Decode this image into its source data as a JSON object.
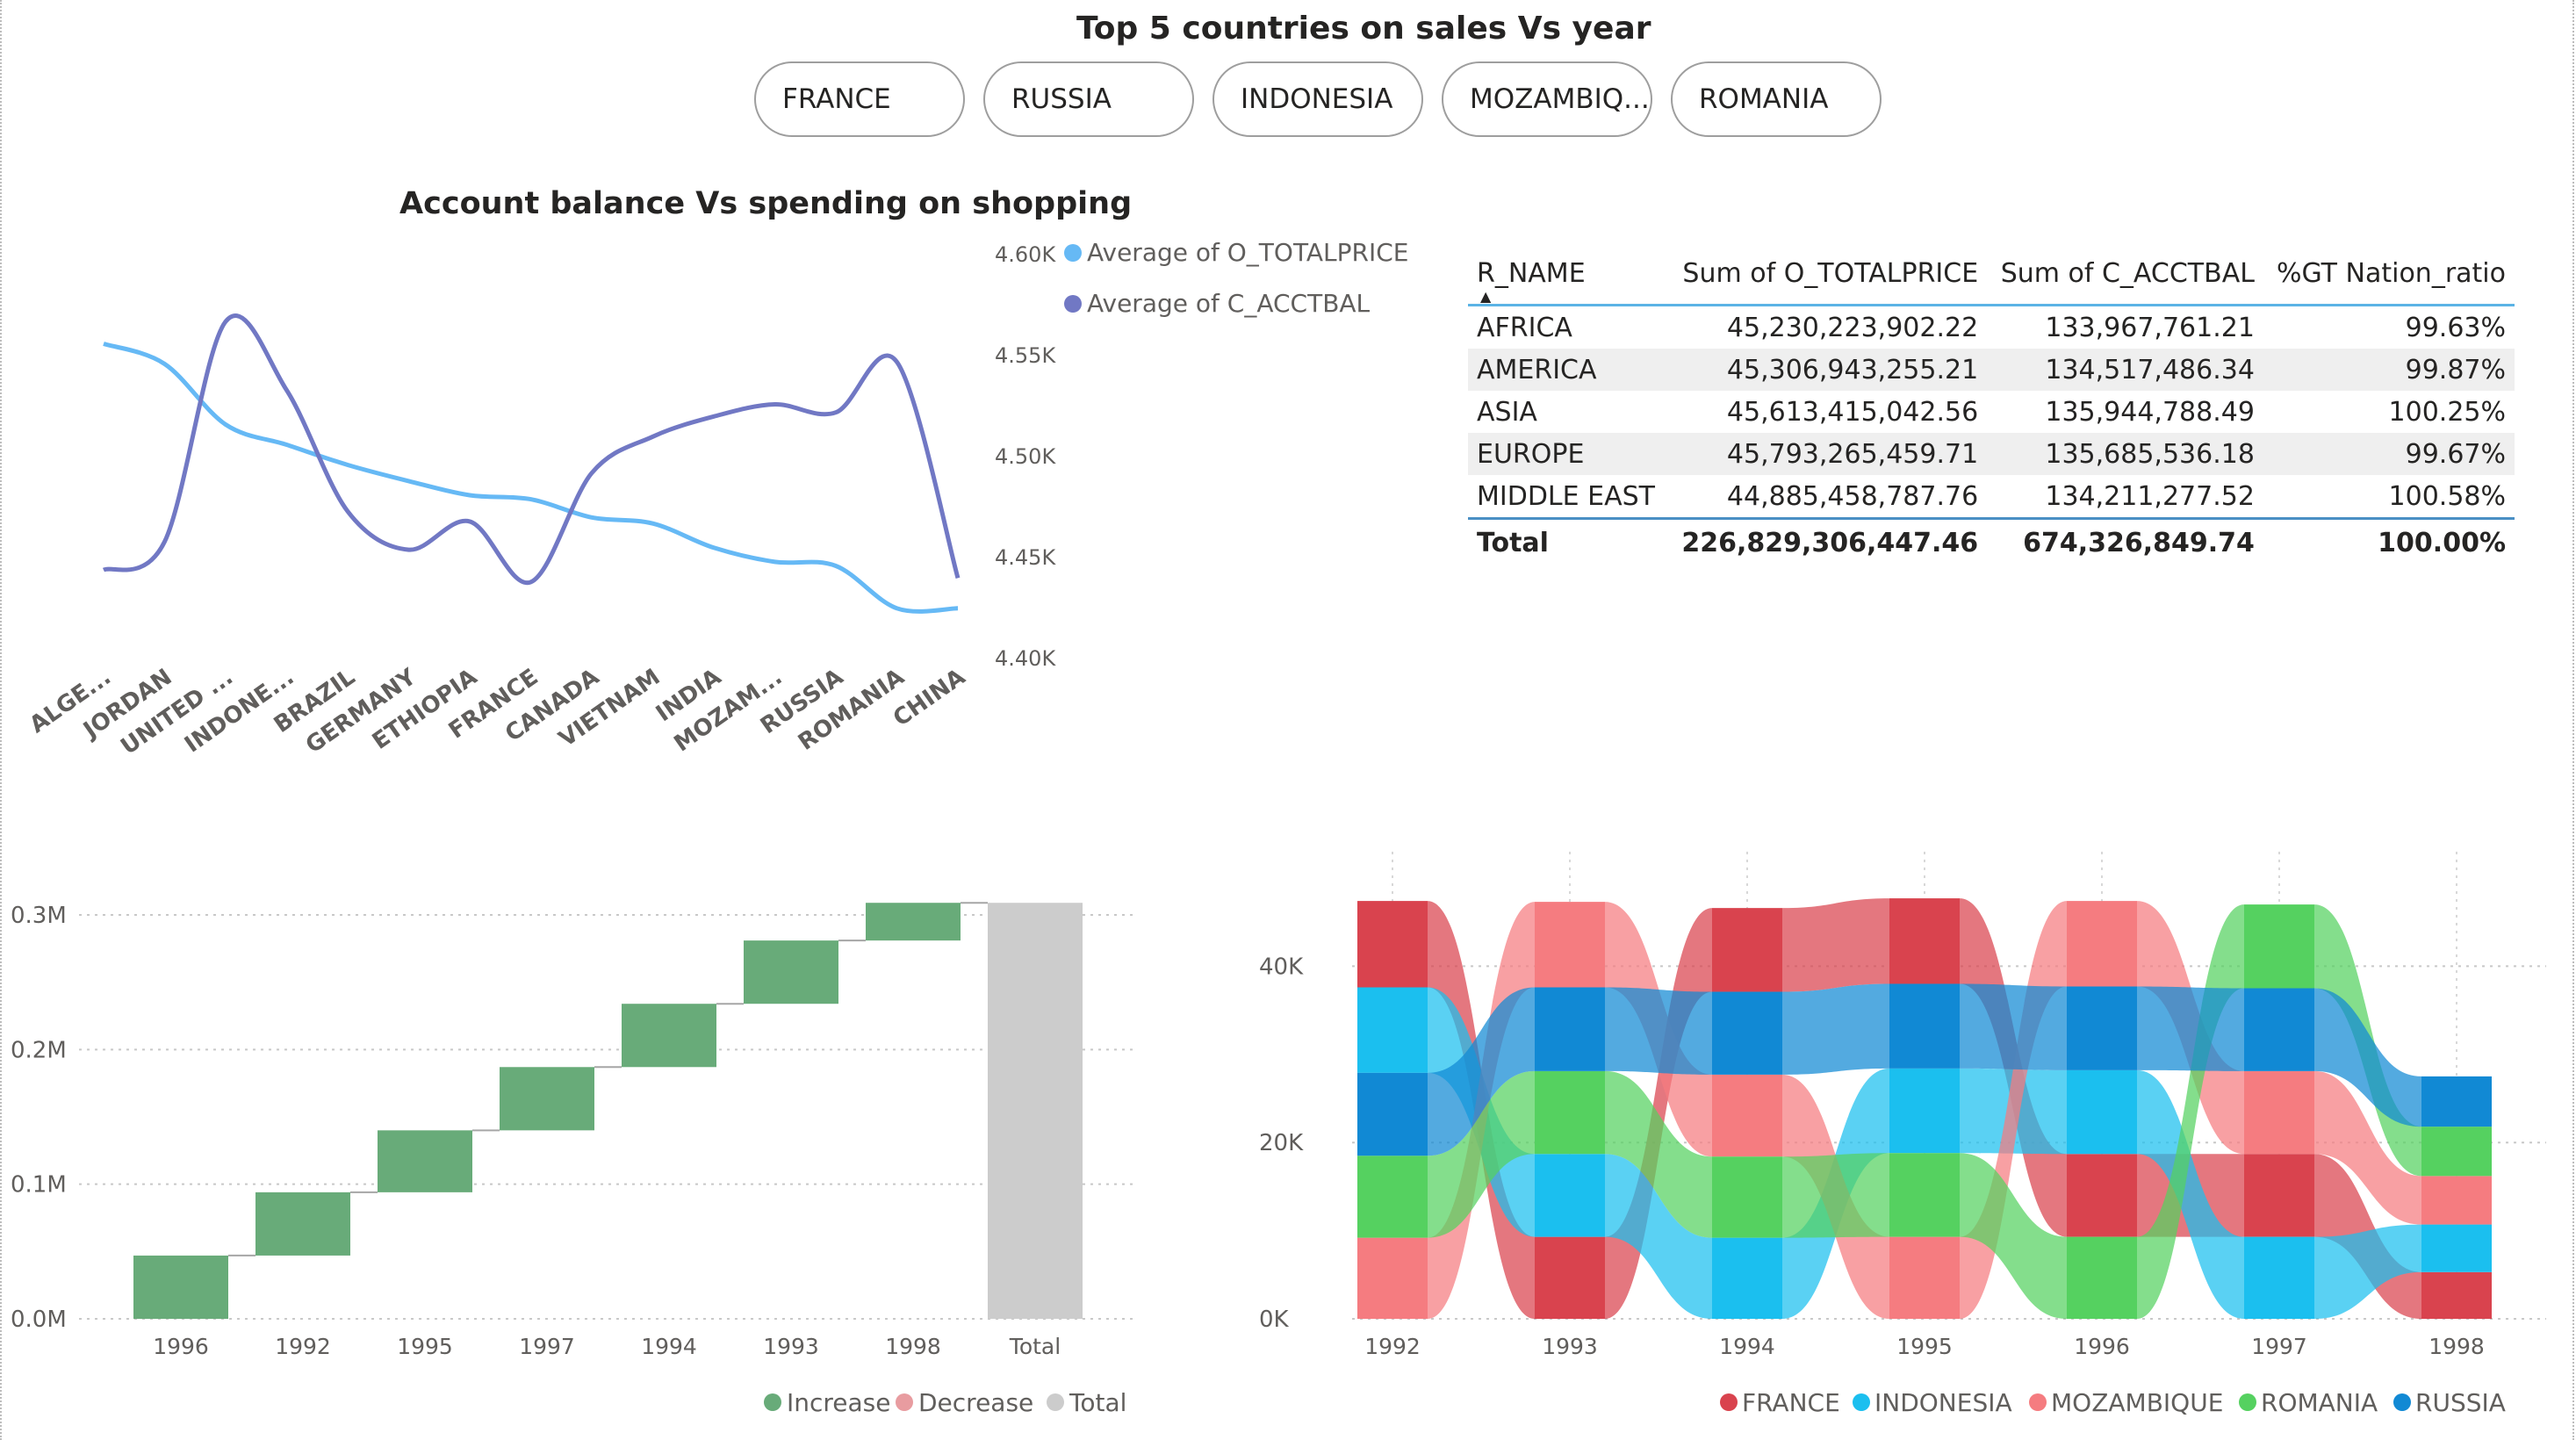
{
  "header": {
    "title": "Top 5 countries on sales Vs year",
    "slicer_buttons": [
      "FRANCE",
      "RUSSIA",
      "INDONESIA",
      "MOZAMBIQ...",
      "ROMANIA"
    ]
  },
  "line_chart": {
    "title": "Account balance Vs spending on shopping",
    "legend": [
      "Average of O_TOTALPRICE",
      "Average of C_ACCTBAL"
    ],
    "y_ticks": [
      "4.60K",
      "4.55K",
      "4.50K",
      "4.45K",
      "4.40K"
    ],
    "x_labels": [
      "ALGE...",
      "JORDAN",
      "UNITED ...",
      "INDONE...",
      "BRAZIL",
      "GERMANY",
      "ETHIOPIA",
      "FRANCE",
      "CANADA",
      "VIETNAM",
      "INDIA",
      "MOZAM...",
      "RUSSIA",
      "ROMANIA",
      "CHINA"
    ],
    "colors": {
      "totalprice": "#66b9f5",
      "acctbal": "#7178c4"
    }
  },
  "table": {
    "columns": [
      "R_NAME",
      "Sum of O_TOTALPRICE",
      "Sum of C_ACCTBAL",
      "%GT Nation_ratio"
    ],
    "rows": [
      [
        "AFRICA",
        "45,230,223,902.22",
        "133,967,761.21",
        "99.63%"
      ],
      [
        "AMERICA",
        "45,306,943,255.21",
        "134,517,486.34",
        "99.87%"
      ],
      [
        "ASIA",
        "45,613,415,042.56",
        "135,944,788.49",
        "100.25%"
      ],
      [
        "EUROPE",
        "45,793,265,459.71",
        "135,685,536.18",
        "99.67%"
      ],
      [
        "MIDDLE EAST",
        "44,885,458,787.76",
        "134,211,277.52",
        "100.58%"
      ]
    ],
    "total": [
      "Total",
      "226,829,306,447.46",
      "674,326,849.74",
      "100.00%"
    ]
  },
  "waterfall": {
    "y_ticks": [
      "0.3M",
      "0.2M",
      "0.1M",
      "0.0M"
    ],
    "legend": [
      "Increase",
      "Decrease",
      "Total"
    ],
    "colors": {
      "increase": "#68ab79",
      "decrease": "#e89ca0",
      "total": "#cccccc"
    }
  },
  "ribbon": {
    "y_ticks": [
      "40K",
      "20K",
      "0K"
    ],
    "legend": [
      "FRANCE",
      "INDONESIA",
      "MOZAMBIQUE",
      "ROMANIA",
      "RUSSIA"
    ],
    "colors": {
      "FRANCE": "#d9434e",
      "INDONESIA": "#1bbfef",
      "MOZAMBIQUE": "#f57c80",
      "ROMANIA": "#55d160",
      "RUSSIA": "#1189d4"
    }
  },
  "chart_data": [
    {
      "type": "line",
      "title": "Account balance Vs spending on shopping",
      "categories": [
        "ALGE...",
        "JORDAN",
        "UNITED ...",
        "INDONE...",
        "BRAZIL",
        "GERMANY",
        "ETHIOPIA",
        "FRANCE",
        "CANADA",
        "VIETNAM",
        "INDIA",
        "MOZAM...",
        "RUSSIA",
        "ROMANIA",
        "CHINA"
      ],
      "ylim": [
        4400,
        4600
      ],
      "series": [
        {
          "name": "Average of O_TOTALPRICE",
          "values": [
            4555,
            4545,
            4515,
            4505,
            4495,
            4487,
            4480,
            4478,
            4469,
            4466,
            4454,
            4447,
            4445,
            4424,
            4424
          ]
        },
        {
          "name": "Average of C_ACCTBAL",
          "values": [
            4443,
            4457,
            4566,
            4532,
            4472,
            4453,
            4467,
            4437,
            4491,
            4509,
            4519,
            4525,
            4521,
            4546,
            4439
          ]
        }
      ]
    },
    {
      "type": "bar",
      "subtype": "waterfall",
      "categories": [
        "1996",
        "1992",
        "1995",
        "1997",
        "1994",
        "1993",
        "1998",
        "Total"
      ],
      "values": [
        47000,
        47000,
        46000,
        47000,
        47000,
        47000,
        28000,
        309000
      ],
      "ylim": [
        0,
        330000
      ]
    },
    {
      "type": "area",
      "subtype": "ribbon",
      "categories": [
        "1992",
        "1993",
        "1994",
        "1995",
        "1996",
        "1997",
        "1998"
      ],
      "ylim": [
        0,
        50000
      ],
      "series": [
        {
          "name": "FRANCE",
          "values": [
            9800,
            9300,
            9500,
            9700,
            9400,
            9400,
            5300
          ]
        },
        {
          "name": "INDONESIA",
          "values": [
            9700,
            9400,
            9200,
            9600,
            9500,
            9300,
            5400
          ]
        },
        {
          "name": "MOZAMBIQUE",
          "values": [
            9200,
            9700,
            9300,
            9300,
            9700,
            9400,
            5500
          ]
        },
        {
          "name": "ROMANIA",
          "values": [
            9300,
            9400,
            9200,
            9500,
            9300,
            9500,
            5600
          ]
        },
        {
          "name": "RUSSIA",
          "values": [
            9400,
            9500,
            9400,
            9600,
            9500,
            9400,
            5700
          ]
        }
      ]
    }
  ]
}
